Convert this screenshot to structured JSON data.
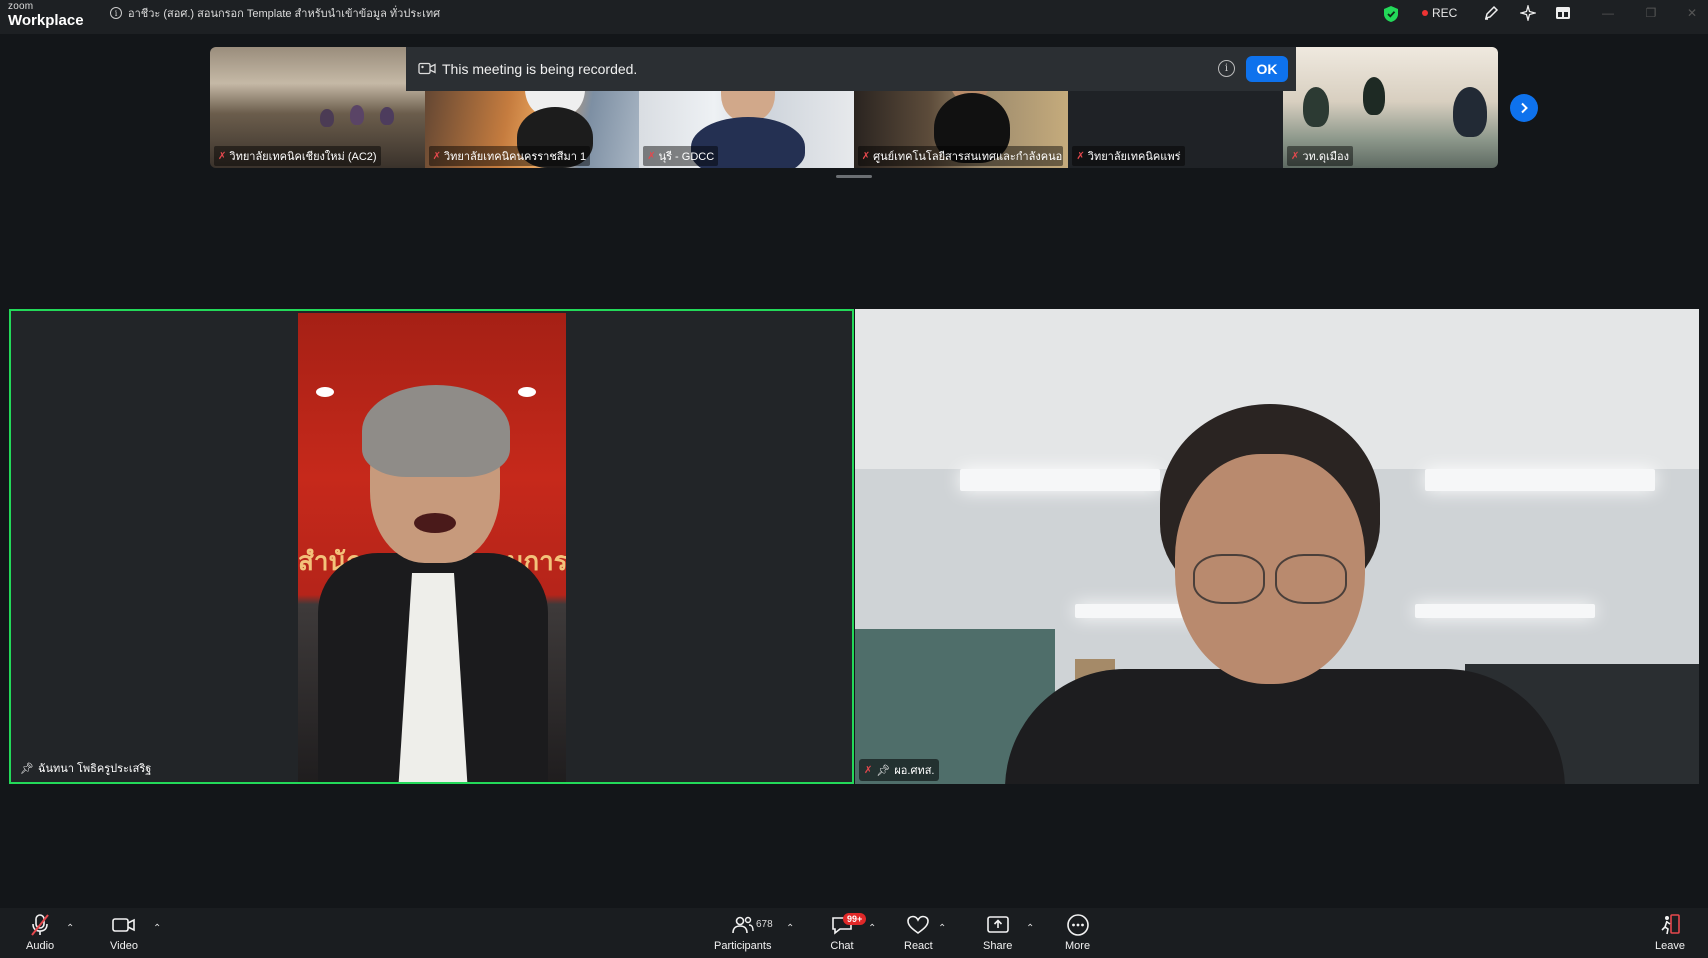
{
  "app": {
    "logo_small": "zoom",
    "logo_big": "Workplace",
    "meeting_title": "อาชีวะ (สอศ.) สอนกรอก Template สำหรับนำเข้าข้อมูล ทั่วประเทศ",
    "rec_label": "REC"
  },
  "banner": {
    "message": "This meeting is being recorded.",
    "ok_label": "OK"
  },
  "thumbnails": [
    {
      "name": "วิทยาลัยเทคนิคเชียงใหม่ (AC2)"
    },
    {
      "name": "วิทยาลัยเทคนิคนครราชสีมา 1"
    },
    {
      "name": "นุรี - GDCC"
    },
    {
      "name": "ศูนย์เทคโนโลยีสารสนเทศและกำลังคนอาชีว..."
    },
    {
      "name": "วิทยาลัยเทคนิคแพร่"
    },
    {
      "name": "วท.ดุเมือง"
    }
  ],
  "tiles": {
    "left": {
      "name": "ฉันทนา โพธิครูประเสริฐ",
      "backdrop_text": "สำนักงานคณะกรรมการการอาชีวศึกษา"
    },
    "right": {
      "name": "ผอ.ศทส."
    }
  },
  "toolbar": {
    "audio": "Audio",
    "video": "Video",
    "participants": "Participants",
    "participants_count": "678",
    "chat": "Chat",
    "chat_badge": "99+",
    "react": "React",
    "share": "Share",
    "more": "More",
    "leave": "Leave"
  },
  "colors": {
    "accent_blue": "#0e72ed",
    "active_speaker_border": "#23d959",
    "mute_red": "#e5484d",
    "shield_green": "#23d959"
  }
}
